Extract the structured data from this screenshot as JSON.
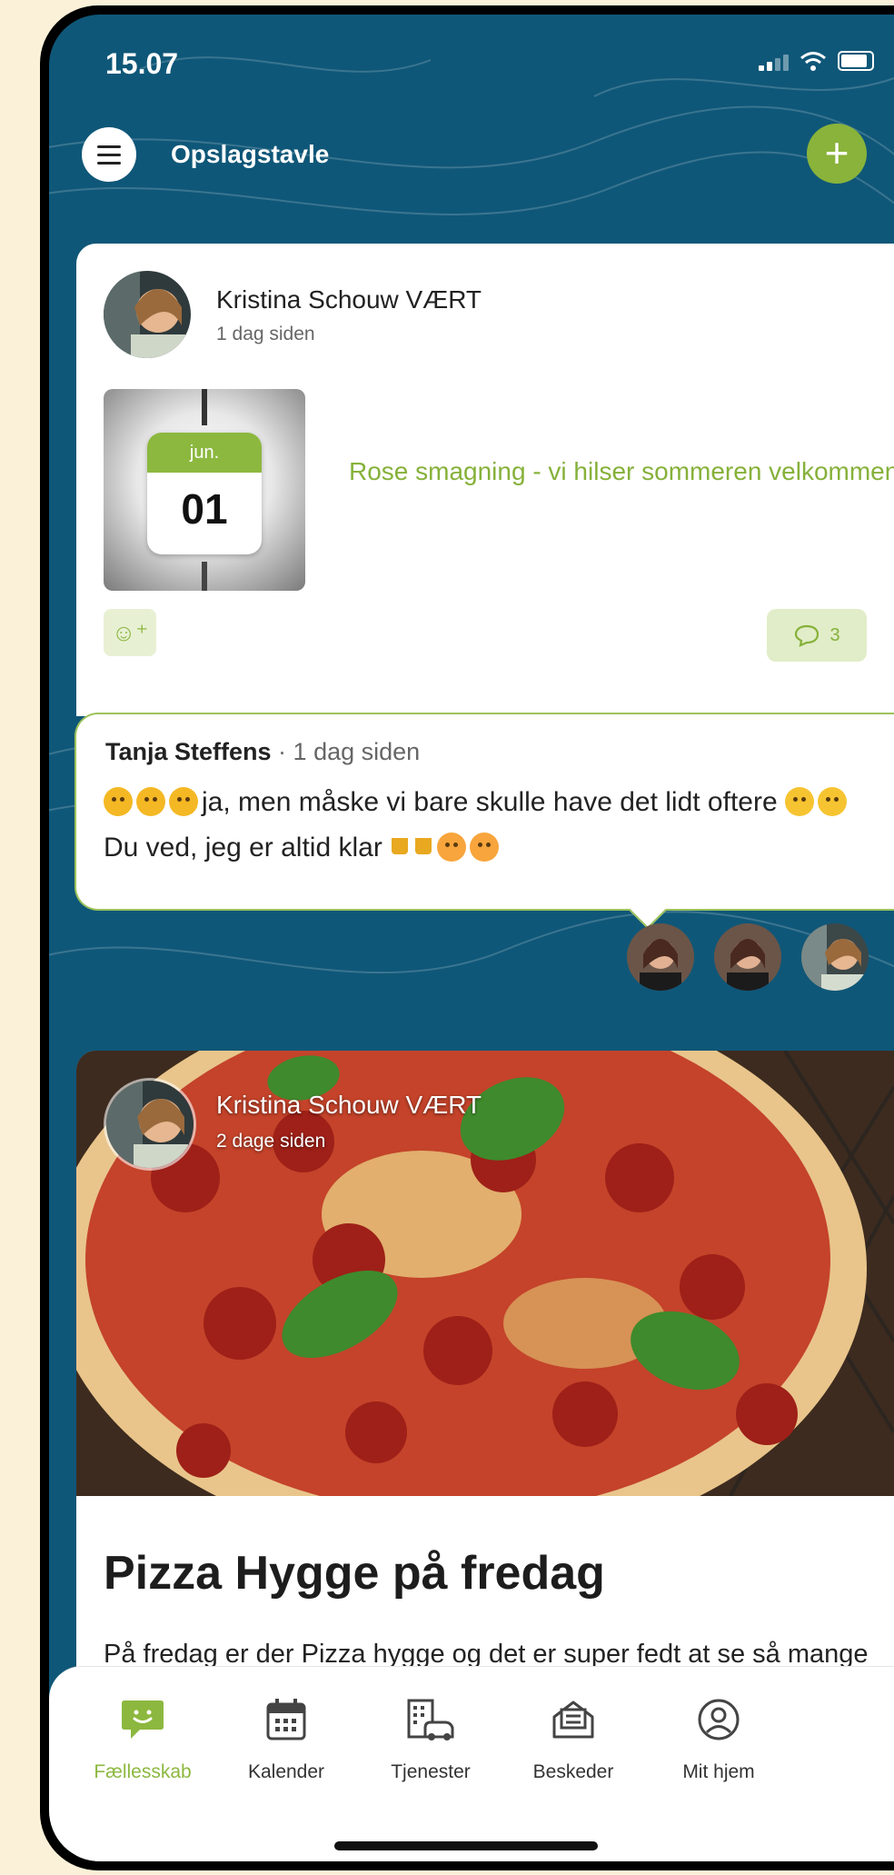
{
  "status_bar": {
    "time": "15.07"
  },
  "header": {
    "title": "Opslagstavle",
    "add_label": "+"
  },
  "post1": {
    "author": "Kristina Schouw VÆRT",
    "time": "1 dag siden",
    "calendar_month": "jun.",
    "calendar_day": "01",
    "event_title": "Rose smagning - vi hilser sommeren velkommen",
    "react_icon": "☺⁺",
    "comment_count": "3"
  },
  "comment": {
    "author": "Tanja Steffens",
    "separator": " · ",
    "time": "1 dag siden",
    "text_part1": "ja, men måske vi bare skulle have det lidt oftere ",
    "text_part2": " Du ved, jeg er altid klar "
  },
  "post2": {
    "author": "Kristina Schouw VÆRT",
    "time": "2 dage siden",
    "title": "Pizza Hygge på fredag",
    "body": "På fredag er der Pizza hygge og det er super fedt at se så mange tilmeldte. Dog er der kun en af jer der"
  },
  "tabbar": {
    "tabs": [
      {
        "label": "Fællesskab",
        "icon": "community-chat-icon"
      },
      {
        "label": "Kalender",
        "icon": "calendar-icon"
      },
      {
        "label": "Tjenester",
        "icon": "building-car-icon"
      },
      {
        "label": "Beskeder",
        "icon": "messages-icon"
      },
      {
        "label": "Mit hjem",
        "icon": "profile-icon"
      }
    ]
  },
  "colors": {
    "accent": "#8cb83f",
    "background": "#0f5778",
    "page": "#fbf1d8"
  }
}
